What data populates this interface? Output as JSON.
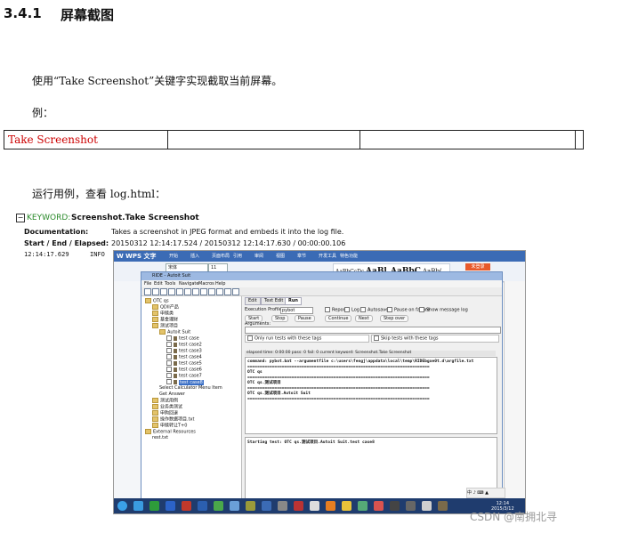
{
  "heading": {
    "number": "3.4.1",
    "title": "屏幕截图"
  },
  "intro": "使用“Take Screenshot”关键字实现截取当前屏幕。",
  "example_label": "例：",
  "table": {
    "keyword": "Take Screenshot",
    "cells": [
      "",
      "",
      ""
    ]
  },
  "run_text": "运行用例，查看 log.html：",
  "log": {
    "toggle": "−",
    "keyword_prefix": "KEYWORD:",
    "keyword_name": "Screenshot.Take Screenshot",
    "documentation_label": "Documentation:",
    "documentation_value": "Takes a screenshot in JPEG format and embeds it into the log file.",
    "time_label": "Start / End / Elapsed:",
    "time_value": "20150312 12:14:17.524 / 20150312 12:14:17.630 / 00:00:00.106",
    "entry_time": "12:14:17.629",
    "entry_level": "INFO"
  },
  "screenshot": {
    "wps_logo": "W WPS 文字",
    "wps_tabs": [
      "开始",
      "插入",
      "页面布局",
      "引用",
      "审阅",
      "视图",
      "章节",
      "开发工具",
      "特色功能"
    ],
    "font_name": "宋体",
    "font_size": "11",
    "style_samples": [
      "AaBbCcDc",
      "AaBl",
      "AaBbC",
      "AaBb("
    ],
    "orange_button": "未登录",
    "ride_title": "RIDE - Autoit Suit",
    "ride_menu": [
      "File",
      "Edit",
      "Tools",
      "Navigate",
      "Macros",
      "Help"
    ],
    "tree": [
      {
        "indent": 0,
        "kind": "folder",
        "label": "OTC qs"
      },
      {
        "indent": 1,
        "kind": "folder",
        "label": "QDII产品"
      },
      {
        "indent": 1,
        "kind": "folder",
        "label": "申赎类"
      },
      {
        "indent": 1,
        "kind": "folder",
        "label": "基金理财"
      },
      {
        "indent": 1,
        "kind": "folder",
        "label": "测试项目"
      },
      {
        "indent": 2,
        "kind": "folder",
        "label": "Autoit Suit"
      },
      {
        "indent": 3,
        "kind": "test",
        "label": "test case"
      },
      {
        "indent": 3,
        "kind": "test",
        "label": "test case2"
      },
      {
        "indent": 3,
        "kind": "test",
        "label": "test case3"
      },
      {
        "indent": 3,
        "kind": "test",
        "label": "test case4"
      },
      {
        "indent": 3,
        "kind": "test",
        "label": "test case5"
      },
      {
        "indent": 3,
        "kind": "test",
        "label": "test case6"
      },
      {
        "indent": 3,
        "kind": "test",
        "label": "test case7"
      },
      {
        "indent": 3,
        "kind": "selected",
        "label": "test case8"
      },
      {
        "indent": 2,
        "kind": "plain",
        "label": "Select Calculator Menu Item"
      },
      {
        "indent": 2,
        "kind": "plain",
        "label": "Get Answer"
      },
      {
        "indent": 1,
        "kind": "folder",
        "label": "测试用例"
      },
      {
        "indent": 1,
        "kind": "folder",
        "label": "业务类测试"
      },
      {
        "indent": 1,
        "kind": "folder",
        "label": "申购回退"
      },
      {
        "indent": 1,
        "kind": "folder",
        "label": "操作数据项目.txt"
      },
      {
        "indent": 1,
        "kind": "folder",
        "label": "申赎转让T+0"
      },
      {
        "indent": 0,
        "kind": "folder",
        "label": "External Resources"
      },
      {
        "indent": 1,
        "kind": "plain",
        "label": "rest.txt"
      }
    ],
    "tabs": [
      "Edit",
      "Text Edit",
      "Run"
    ],
    "execution_profile_label": "Execution Profile:",
    "execution_profile_value": "pybot",
    "run_options": [
      "Report",
      "Log",
      "Autosave",
      "Pause on failure",
      "Show message log"
    ],
    "run_buttons": [
      "Start",
      "Stop",
      "Pause",
      "Continue",
      "Next",
      "Step over"
    ],
    "arguments_label": "Arguments:",
    "filter_include": "Only run tests with these tags",
    "filter_exclude": "Skip tests with these tags",
    "status_line": "elapsed time: 0:00:00     pass: 0     fail: 0     current keyword: Screenshot.Take Screenshot",
    "console": [
      "command: pybot.bat --argumentfile c:\\users\\fengj\\appdata\\local\\temp\\RIDEbgxe0t.d\\argfile.txt",
      "==========================================================================",
      "OTC qs",
      "==========================================================================",
      "OTC qs.测试项目",
      "==========================================================================",
      "OTC qs.测试项目.Autoit Suit",
      "=========================================================================="
    ],
    "message_log": "Starting test: OTC qs.测试项目.Autoit Suit.test case8",
    "tray_text": "中 ♪ ⌨ ▲",
    "clock_time": "12:14",
    "clock_date": "2015/3/12"
  },
  "watermark": "CSDN @南拥北寻",
  "colors": {
    "keyword_cell": "#cc0000",
    "keyword_prefix": "#2a8a2a"
  }
}
